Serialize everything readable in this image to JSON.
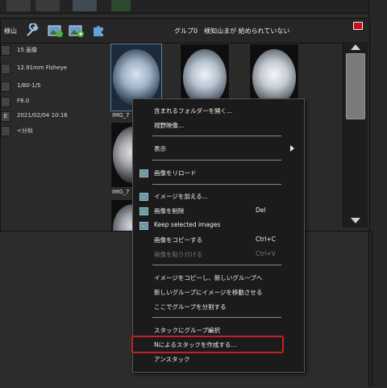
{
  "colors": {
    "accent": "#c81e28",
    "menu_bg": "#1b1b1b",
    "panel_bg": "#2a2a2a",
    "close": "#c8101a"
  },
  "header": {
    "search_label": "検山",
    "group_title": "グルプ0　検知山まが 給められていない",
    "icons": [
      "wrench-icon",
      "image-edit-icon",
      "image-add-icon",
      "puzzle-icon"
    ]
  },
  "info": [
    {
      "badge": "",
      "text": "15 画像"
    },
    {
      "badge": "",
      "text": "12.91mm Fisheye"
    },
    {
      "badge": "",
      "text": "1/80-1/5"
    },
    {
      "badge": "",
      "text": "F8.0"
    },
    {
      "badge": "E",
      "text": "2021/02/04 10:16"
    },
    {
      "badge": "",
      "text": "<分似"
    }
  ],
  "thumbnails": {
    "labels": [
      "IMG_7",
      "IMG_7"
    ]
  },
  "context_menu": {
    "items": [
      {
        "label": "含まれるフォルダーを開く...",
        "shortcut": "",
        "icon": false,
        "disabled": false,
        "submenu": false
      },
      {
        "label": "視野映像...",
        "shortcut": "",
        "icon": false,
        "disabled": false,
        "submenu": false
      },
      {
        "label": "表示",
        "shortcut": "",
        "icon": false,
        "disabled": false,
        "submenu": true
      },
      {
        "label": "画像をリロード",
        "shortcut": "",
        "icon": true,
        "disabled": false,
        "submenu": false
      },
      {
        "label": "イメージを加える...",
        "shortcut": "",
        "icon": true,
        "disabled": false,
        "submenu": false
      },
      {
        "label": "画像を削除",
        "shortcut": "Del",
        "icon": true,
        "disabled": false,
        "submenu": false
      },
      {
        "label": "Keep selected images",
        "shortcut": "",
        "icon": true,
        "disabled": false,
        "submenu": false
      },
      {
        "label": "画像をコピーする",
        "shortcut": "Ctrl+C",
        "icon": false,
        "disabled": false,
        "submenu": false
      },
      {
        "label": "画像を貼り付ける",
        "shortcut": "Ctrl+V",
        "icon": false,
        "disabled": true,
        "submenu": false
      },
      {
        "label": "イメージをコピーし、新しいグループへ",
        "shortcut": "",
        "icon": false,
        "disabled": false,
        "submenu": false
      },
      {
        "label": "新しいグループにイメージを移動させる",
        "shortcut": "",
        "icon": false,
        "disabled": false,
        "submenu": false
      },
      {
        "label": "ここでグループを分割する",
        "shortcut": "",
        "icon": false,
        "disabled": false,
        "submenu": false
      },
      {
        "label": "スタックにグループ編択",
        "shortcut": "",
        "icon": false,
        "disabled": false,
        "submenu": false
      },
      {
        "label": "Nによるスタックを作成する...",
        "shortcut": "",
        "icon": false,
        "disabled": false,
        "submenu": false
      },
      {
        "label": "アンスタック",
        "shortcut": "",
        "icon": false,
        "disabled": false,
        "submenu": false
      }
    ]
  }
}
